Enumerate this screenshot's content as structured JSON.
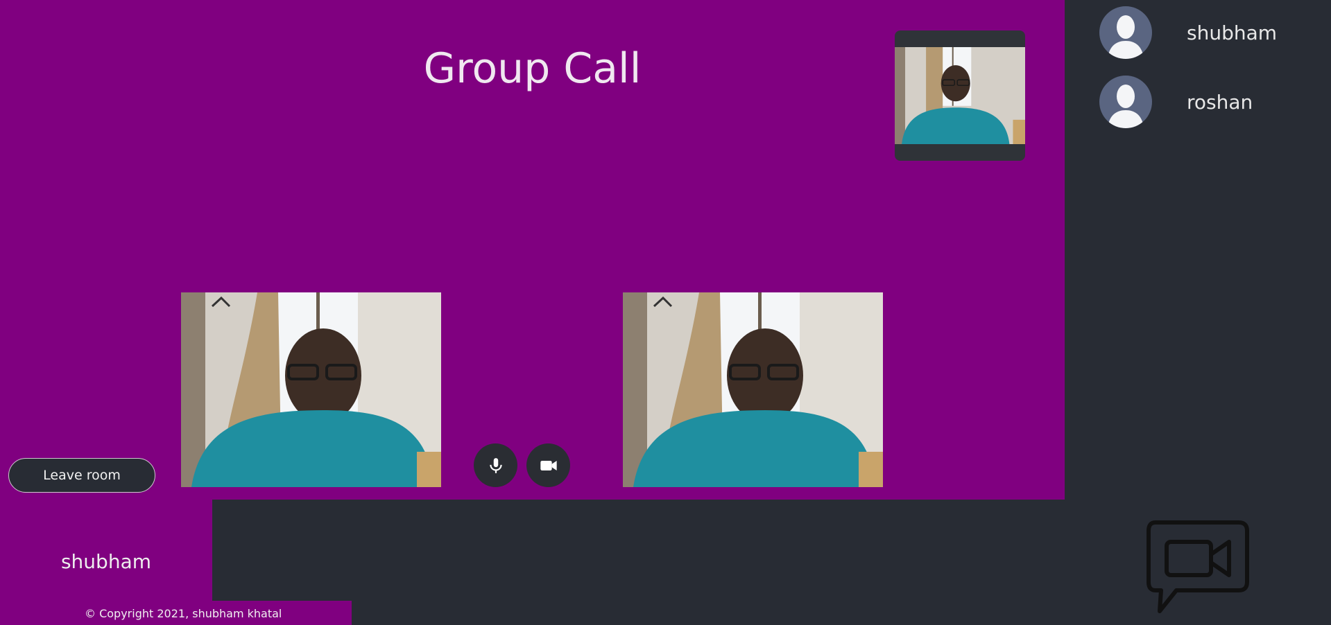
{
  "title": "Group Call",
  "controls": {
    "leave_label": "Leave room",
    "mic_icon": "microphone-icon",
    "camera_icon": "video-camera-icon"
  },
  "participants": [
    {
      "name": "shubham",
      "icon": "user-avatar-icon"
    },
    {
      "name": "roshan",
      "icon": "user-avatar-icon"
    }
  ],
  "footer": {
    "username": "shubham",
    "copyright": "Copyright 2021, shubham khatal"
  },
  "icons": {
    "chat": "video-chat-icon"
  },
  "colors": {
    "main_bg": "#800080",
    "sidebar_bg": "#282c34"
  }
}
